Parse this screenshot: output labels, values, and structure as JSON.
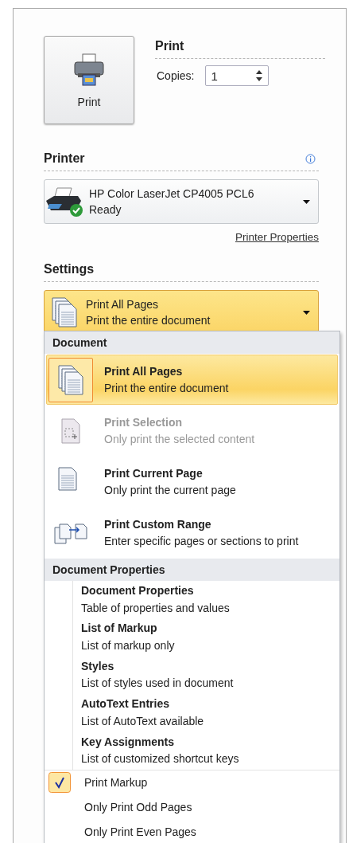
{
  "print": {
    "heading": "Print",
    "button_label": "Print",
    "copies_label": "Copies:",
    "copies_value": "1"
  },
  "printer": {
    "heading": "Printer",
    "name": "HP Color LaserJet CP4005 PCL6",
    "status": "Ready",
    "properties_link": "Printer Properties"
  },
  "settings": {
    "heading": "Settings",
    "dropdown": {
      "title": "Print All Pages",
      "subtitle": "Print the entire document",
      "expanded": true
    }
  },
  "menu": {
    "document_heading": "Document",
    "document_items": [
      {
        "title": "Print All Pages",
        "description": "Print the entire document",
        "selected": true,
        "disabled": false
      },
      {
        "title": "Print Selection",
        "description": "Only print the selected content",
        "selected": false,
        "disabled": true
      },
      {
        "title": "Print Current Page",
        "description": "Only print the current page",
        "selected": false,
        "disabled": false
      },
      {
        "title": "Print Custom Range",
        "description": "Enter specific pages or sections to print",
        "selected": false,
        "disabled": false
      }
    ],
    "properties_heading": "Document Properties",
    "property_items": [
      {
        "title": "Document Properties",
        "description": "Table of properties and values"
      },
      {
        "title": "List of Markup",
        "description": "List of markup only"
      },
      {
        "title": "Styles",
        "description": "List of styles used in document"
      },
      {
        "title": "AutoText Entries",
        "description": "List of AutoText available"
      },
      {
        "title": "Key Assignments",
        "description": "List of customized shortcut keys"
      }
    ],
    "check_items": [
      {
        "label": "Print Markup",
        "checked": true
      },
      {
        "label": "Only Print Odd Pages",
        "checked": false
      },
      {
        "label": "Only Print Even Pages",
        "checked": false
      }
    ]
  }
}
